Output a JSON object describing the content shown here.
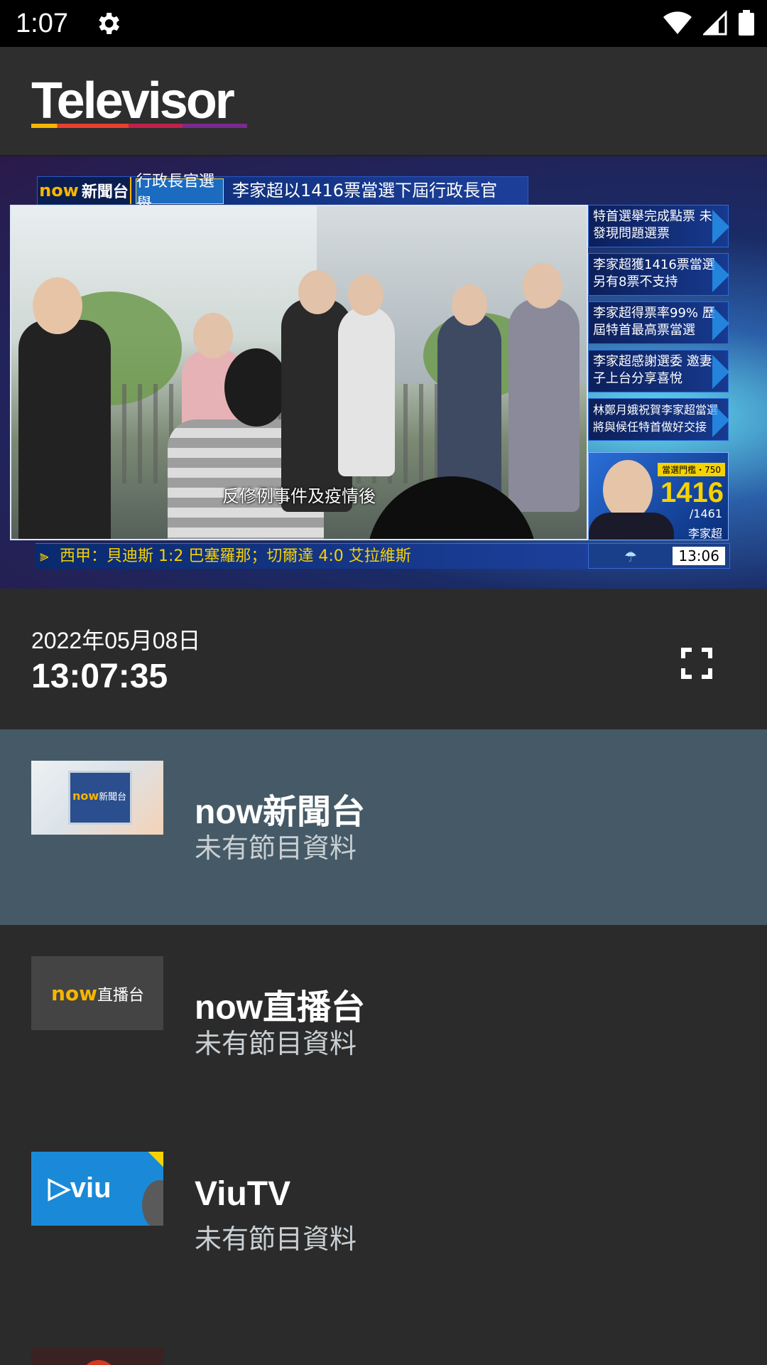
{
  "status_bar": {
    "time": "1:07",
    "icons": [
      "gear-icon",
      "wifi-icon",
      "signal-icon",
      "battery-icon"
    ]
  },
  "app_bar": {
    "logo_text": "Televisor",
    "logo_colors": [
      "#f6b600",
      "#e8402e",
      "#c0224a",
      "#7a2a8e"
    ]
  },
  "video": {
    "channel_tag": "now",
    "channel_tag_suffix": "新聞台",
    "section_tag": "行政長官選舉",
    "headline": "李家超以1416票當選下屆行政長官",
    "subtitle": "反修例事件及疫情後",
    "side_items": [
      "特首選舉完成點票 未發現問題選票",
      "李家超獲1416票當選 另有8票不支持",
      "李家超得票率99% 歷屆特首最高票當選",
      "李家超感謝選委 邀妻子上台分享喜悅",
      "林鄭月娥祝賀李家超當選 將與候任特首做好交接"
    ],
    "vote_label": "當選門檻・750",
    "vote_count": "1416",
    "vote_total": "/1461",
    "candidate_name": "李家超",
    "ticker": "西甲：貝迪斯 1:2 巴塞羅那；切爾達 4:0 艾拉維斯",
    "clock": "13:06"
  },
  "info": {
    "date": "2022年05月08日",
    "time": "13:07:35",
    "fullscreen_icon": "fullscreen-icon"
  },
  "channels": [
    {
      "name": "now新聞台",
      "desc": "未有節目資料",
      "thumb_label": "now",
      "thumb_suffix": "新聞台",
      "selected": true
    },
    {
      "name": "now直播台",
      "desc": "未有節目資料",
      "thumb_label": "now",
      "thumb_suffix": "直播台",
      "selected": false
    },
    {
      "name": "ViuTV",
      "desc": "未有節目資料",
      "thumb_label": "▷viu",
      "thumb_suffix": "",
      "selected": false
    }
  ],
  "accent": {
    "selected_row": "#455a66",
    "background": "#2b2b2b"
  }
}
